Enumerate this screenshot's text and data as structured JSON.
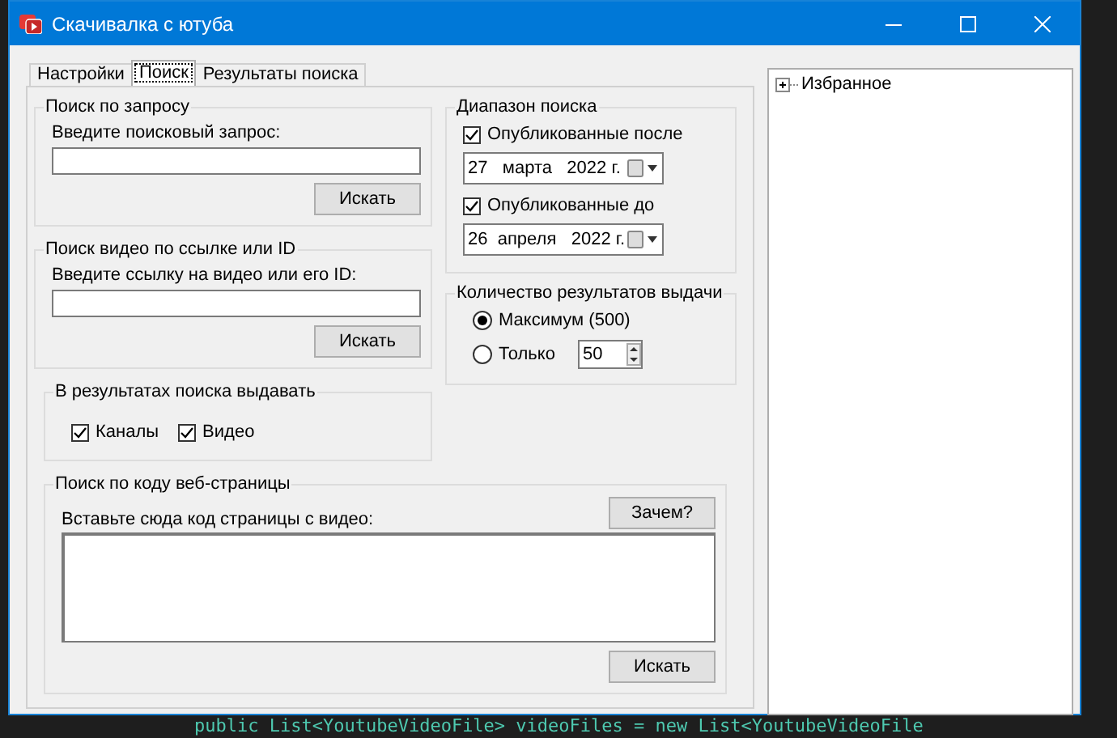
{
  "window": {
    "title": "Скачивалка с ютуба"
  },
  "tabs": [
    {
      "label": "Настройки",
      "selected": false
    },
    {
      "label": "Поиск",
      "selected": true
    },
    {
      "label": "Результаты поиска",
      "selected": false
    }
  ],
  "query_group": {
    "title": "Поиск по запросу",
    "label": "Введите поисковый запрос:",
    "button": "Искать"
  },
  "link_group": {
    "title": "Поиск видео по ссылке или ID",
    "label": "Введите ссылку на видео или его ID:",
    "button": "Искать"
  },
  "result_types": {
    "title": "В результатах поиска выдавать",
    "options": [
      {
        "label": "Каналы",
        "checked": true
      },
      {
        "label": "Видео",
        "checked": true
      }
    ]
  },
  "date_range": {
    "title": "Диапазон поиска",
    "filters": [
      {
        "label": "Опубликованные после",
        "checked": true,
        "date": "27   марта   2022 г."
      },
      {
        "label": "Опубликованные до",
        "checked": true,
        "date": "26  апреля   2022 г."
      }
    ]
  },
  "result_count": {
    "title": "Количество результатов выдачи",
    "options": [
      {
        "label": "Максимум (500)",
        "selected": true
      },
      {
        "label": "Только",
        "selected": false,
        "value": "50"
      }
    ]
  },
  "page_code_group": {
    "title": "Поиск по коду веб-страницы",
    "help_button": "Зачем?",
    "label": "Вставьте сюда код страницы с видео:",
    "button": "Искать"
  },
  "tree": {
    "items": [
      {
        "label": "Избранное",
        "expanded": false
      }
    ]
  },
  "background_code": {
    "line": "public List<YoutubeVideoFile> videoFiles = new List<YoutubeVideoFile"
  }
}
